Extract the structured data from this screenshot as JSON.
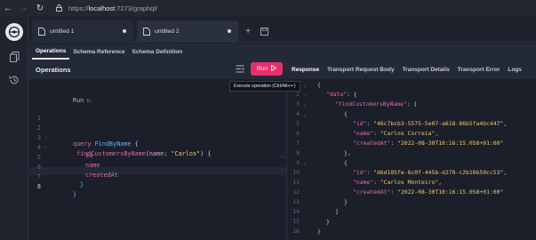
{
  "browser": {
    "url_prefix": "https://",
    "url_host": "localhost",
    "url_rest": ":7273/graphql/"
  },
  "tabs": [
    {
      "label": "untitled 1"
    },
    {
      "label": "untitled 2"
    }
  ],
  "subtabs": [
    "Operations",
    "Schema Reference",
    "Schema Definition"
  ],
  "operations": {
    "title": "Operations",
    "run_label": "Run",
    "tooltip": "Execute operation (Ctrl/Alt+↵)"
  },
  "response_tabs": [
    "Response",
    "Transport Request Body",
    "Transport Details",
    "Transport Error",
    "Logs"
  ],
  "editor": {
    "run_hint": "Run ▷",
    "line_numbers": [
      "1",
      "2",
      "3",
      "4",
      "5",
      "6",
      "7",
      "8"
    ],
    "lines": {
      "query_kw": "query",
      "query_name": "FindByName",
      "field": "findCustomersByName",
      "arg_name": "name",
      "arg_value": "\"Carlos\"",
      "f_id": "id",
      "f_name": "name",
      "f_created": "createdAt"
    }
  },
  "response": {
    "line_numbers": [
      "1",
      "2",
      "3",
      "4",
      "5",
      "6",
      "7",
      "8",
      "9",
      "10",
      "11",
      "12",
      "13",
      "14",
      "15",
      "16"
    ],
    "data_key": "\"data\"",
    "field_key": "\"findCustomersByName\"",
    "items": [
      {
        "id": "\"46c7bcb3-5575-5e07-a618-86b5fa4bc447\"",
        "name": "\"Carlos Correia\"",
        "createdAt": "\"2022-08-30T10:16:15.058+01:00\""
      },
      {
        "id": "\"d6d185fe-6c0f-445b-d270-c2b10b59cc53\"",
        "name": "\"Carlos Monteiro\"",
        "createdAt": "\"2022-08-30T10:16:15.058+01:00\""
      }
    ],
    "keys": {
      "id": "\"id\"",
      "name": "\"name\"",
      "createdAt": "\"createdAt\""
    }
  }
}
